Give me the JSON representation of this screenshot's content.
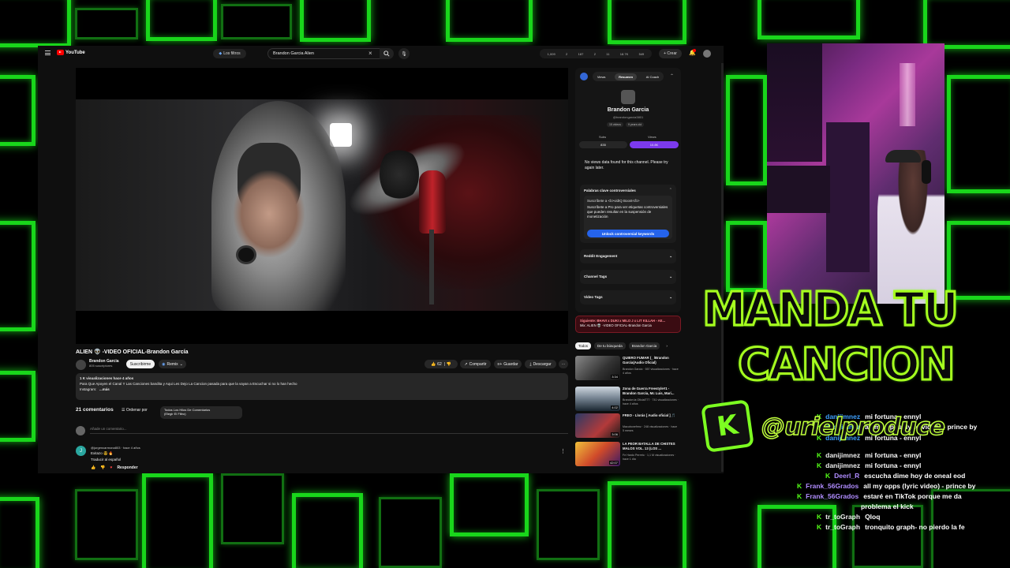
{
  "youtube": {
    "logo_text": "YouTube",
    "filter_chip": "Los filtros",
    "search_value": "Brandon Garcia Alien",
    "stats": [
      "1,009",
      "2",
      "187",
      "2",
      "11",
      "18.7K",
      "549"
    ],
    "create_label": "Crear",
    "video": {
      "title": "ALIEN 👽 -VIDEO OFICIAL-Brandon García",
      "channel": "Brandon Garcia",
      "subscribers": "805 suscriptores",
      "subscribe_label": "Suscribirme",
      "remix_label": "Remix",
      "likes": "62",
      "share_label": "Compartir",
      "save_label": "Guardar",
      "download_label": "Descargar",
      "desc_line1": "1 K visualizaciones  hace 4 años",
      "desc_line2": "Para Que Apoyen el Canal Y Las Canciones bandita y Aqui Les Dejo La Cancion pasada para que la vayan a Escuchar si no lo han hecho",
      "desc_line3_label": "Instagram:",
      "desc_more": "...más",
      "comments_count": "21 comentarios",
      "sort_label": "Ordenar por",
      "comment_filter_line1": "Todos Los Hilos De Comentarios",
      "comment_filter_line2": "(Elegir El Filtro)",
      "add_comment_placeholder": "Añade un comentario...",
      "comment": {
        "avatar_letter": "J",
        "user": "@jurgencarmona803 · hace 4 años",
        "text": "Exitazo 😎 🔥",
        "translate": "Traducir al español",
        "reply_label": "Responder"
      }
    },
    "panel": {
      "tabs": [
        "Views",
        "Resumen",
        "AI Coach"
      ],
      "active_tab": "Resumen",
      "channel_name": "Brandon Garcia",
      "channel_handle": "@brandongarcia3801",
      "chips": [
        "15 videos",
        "9 years old"
      ],
      "subs_label": "Subs",
      "views_label": "Views",
      "subs_value": "835",
      "views_value": "10.8K",
      "no_views": "No views data found for this channel. Please try again later.",
      "keywords_title": "Palabras clave controversiales",
      "promo_title": "Suscríbete a <b>vidIQ Boost</b>",
      "promo_text": "Suscríbete a Pro para ver etiquetas controversiales que pueden resultar en la suspensión de monetización",
      "unlock_label": "Unlock controversial keywords",
      "sections": [
        "Reddit Engagement",
        "Channel Tags",
        "Video Tags"
      ]
    },
    "up_next": {
      "label": "Siguiente: BHAVI x DUKI x MILO J x LIT KILLAH - AE...",
      "sub": "Mix: ALIEN 👽 -VIDEO OFICIAL-Brandon Garcia"
    },
    "rec_tabs": [
      "Todos",
      "De tu búsqueda",
      "Brandon Garcia"
    ],
    "recs": [
      {
        "title": "QUIERO FUMAR (_ /Brandon García(Audio Oficial)",
        "meta": "Brandon García · 557 visualizaciones · hace 4 años",
        "duration": "3:34"
      },
      {
        "title": "Zona de Guerra Freestyle#1 - Brandon García, Mc Luis, Mari...",
        "meta": "Brandon la Oficial777 · 741 visualizaciones · hace 4 años",
        "duration": "4:02"
      },
      {
        "title": "FREO - Llorás [ Audio oficial ] 🎵",
        "meta": "Macubonefrmz · 248 visualizaciones · hace 5 meses",
        "duration": "3:06"
      },
      {
        "title": "LA PEOR BATALLA DE CHISTES MALOS VOL. 13 (LOS ...",
        "meta": "Fe Hardo Perreto · 1,1 M visualizaciones · hace 1 día",
        "duration": "42:07"
      }
    ]
  },
  "overlay": {
    "banner_line1": "MANDA TU",
    "banner_line2": "CANCION",
    "kick_letter": "K",
    "handle": "@urielproduce",
    "chat": [
      {
        "user": "danijimnez",
        "message": "mi fortuna - ennyl",
        "color": "#3ea0ff"
      },
      {
        "user": "danijimnez",
        "message": "all my opps (lyric video) - prince by",
        "color": "#3ea0ff"
      },
      {
        "user": "danijimnez",
        "message": "mi fortuna - ennyl",
        "color": "#3ea0ff"
      },
      {
        "user": "danijimnez",
        "message": "mi fortuna - ennyl",
        "color": "#f0f0f0"
      },
      {
        "user": "danijimnez",
        "message": "mi fortuna - ennyl",
        "color": "#f0f0f0"
      },
      {
        "user": "Deerl_R",
        "message": "escucha dime hoy de oneal eod",
        "color": "#b08cff"
      },
      {
        "user": "Frank_56Grados",
        "message": "all my opps (lyric video) - prince by",
        "color": "#b08cff"
      },
      {
        "user": "Frank_56Grados",
        "message": "estaré en TikTok porque me da",
        "color": "#b08cff"
      },
      {
        "user": "",
        "message": "problema el kick",
        "color": "#f0f0f0"
      },
      {
        "user": "tr_toGraph",
        "message": "Qloq",
        "color": "#f0f0f0"
      },
      {
        "user": "tr_toGraph",
        "message": "tronquito graph- no pierdo la fe",
        "color": "#f0f0f0"
      }
    ]
  }
}
